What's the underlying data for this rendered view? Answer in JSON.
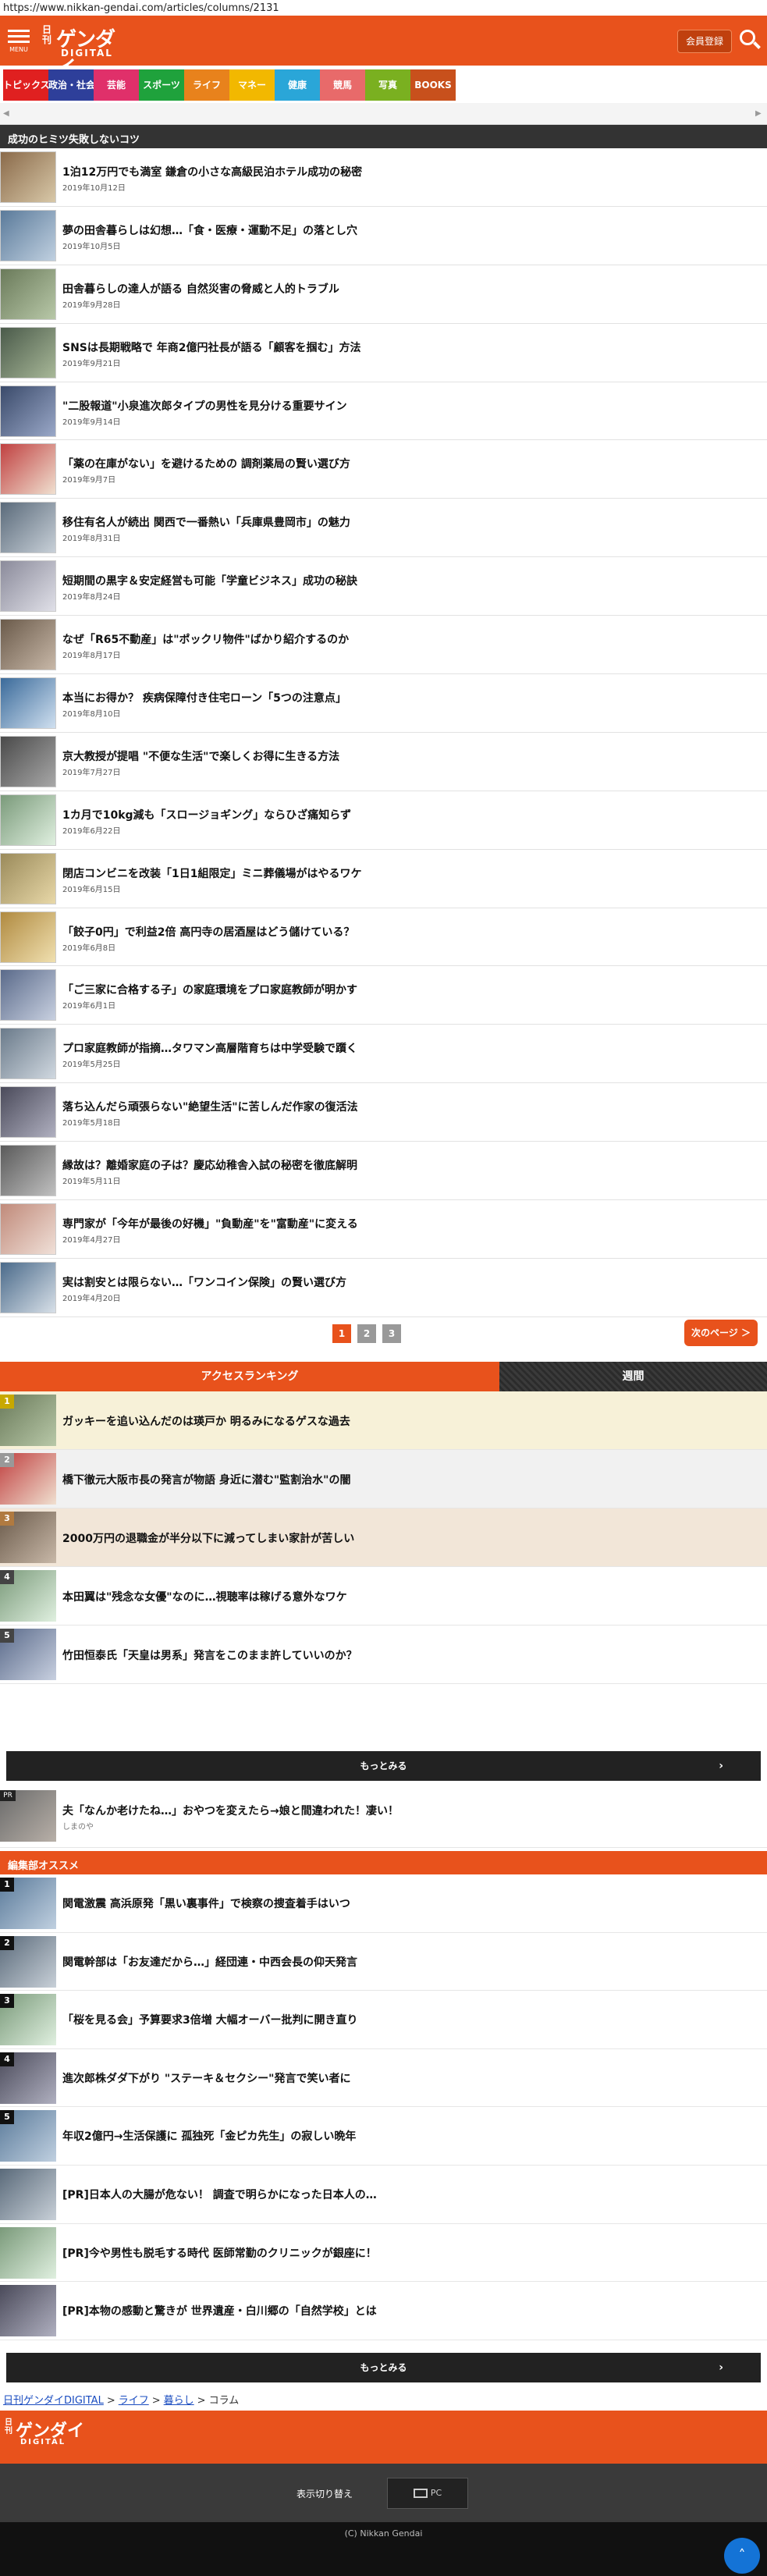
{
  "browser": {
    "url": "https://www.nikkan-gendai.com/articles/columns/2131"
  },
  "header": {
    "menu_label": "MENU",
    "logo_nikkan": "日刊",
    "logo_gendai": "ゲンダイ",
    "logo_digital": "DIGITAL",
    "member_button": "会員登録",
    "brand_color": "#e8521c"
  },
  "categories": [
    {
      "label": "トピックス",
      "color": "#e02020"
    },
    {
      "label": "政治・社会",
      "color": "#2e3f9a"
    },
    {
      "label": "芸能",
      "color": "#e0306a"
    },
    {
      "label": "スポーツ",
      "color": "#1fa23c"
    },
    {
      "label": "ライフ",
      "color": "#e8821c"
    },
    {
      "label": "マネー",
      "color": "#f2b800"
    },
    {
      "label": "健康",
      "color": "#2aa6d8"
    },
    {
      "label": "競馬",
      "color": "#e86a6a"
    },
    {
      "label": "写真",
      "color": "#7ab020"
    },
    {
      "label": "BOOKS",
      "color": "#c8501c"
    }
  ],
  "section_title": "成功のヒミツ失敗しないコツ",
  "articles": [
    {
      "title": "1泊12万円でも満室 鎌倉の小さな高級民泊ホテル成功の秘密",
      "date": "2019年10月12日"
    },
    {
      "title": "夢の田舎暮らしは幻想…「食・医療・運動不足」の落とし穴",
      "date": "2019年10月5日"
    },
    {
      "title": "田舎暮らしの達人が語る 自然災害の脅威と人的トラブル",
      "date": "2019年9月28日"
    },
    {
      "title": "SNSは長期戦略で 年商2億円社長が語る「顧客を掴む」方法",
      "date": "2019年9月21日"
    },
    {
      "title": "\"二股報道\"小泉進次郎タイプの男性を見分ける重要サイン",
      "date": "2019年9月14日"
    },
    {
      "title": "「薬の在庫がない」を避けるための 調剤薬局の賢い選び方",
      "date": "2019年9月7日"
    },
    {
      "title": "移住有名人が続出 関西で一番熱い「兵庫県豊岡市」の魅力",
      "date": "2019年8月31日"
    },
    {
      "title": "短期間の黒字＆安定経営も可能「学童ビジネス」成功の秘訣",
      "date": "2019年8月24日"
    },
    {
      "title": "なぜ「R65不動産」は\"ポックリ物件\"ばかり紹介するのか",
      "date": "2019年8月17日"
    },
    {
      "title": "本当にお得か？ 疾病保障付き住宅ローン「5つの注意点」",
      "date": "2019年8月10日"
    },
    {
      "title": "京大教授が提唱 \"不便な生活\"で楽しくお得に生きる方法",
      "date": "2019年7月27日"
    },
    {
      "title": "1カ月で10kg減も「スロージョギング」ならひざ痛知らず",
      "date": "2019年6月22日"
    },
    {
      "title": "閉店コンビニを改装「1日1組限定」ミニ葬儀場がはやるワケ",
      "date": "2019年6月15日"
    },
    {
      "title": "「餃子0円」で利益2倍 高円寺の居酒屋はどう儲けている？",
      "date": "2019年6月8日"
    },
    {
      "title": "「ご三家に合格する子」の家庭環境をプロ家庭教師が明かす",
      "date": "2019年6月1日"
    },
    {
      "title": "プロ家庭教師が指摘…タワマン高層階育ちは中学受験で躓く",
      "date": "2019年5月25日"
    },
    {
      "title": "落ち込んだら頑張らない\"絶望生活\"に苦しんだ作家の復活法",
      "date": "2019年5月18日"
    },
    {
      "title": "縁故は？離婚家庭の子は？慶応幼稚舎入試の秘密を徹底解明",
      "date": "2019年5月11日"
    },
    {
      "title": "専門家が「今年が最後の好機」\"負動産\"を\"富動産\"に変える",
      "date": "2019年4月27日"
    },
    {
      "title": "実は割安とは限らない…「ワンコイン保険」の賢い選び方",
      "date": "2019年4月20日"
    }
  ],
  "pager": {
    "pages": [
      "1",
      "2",
      "3"
    ],
    "next_label": "次のページ ＞"
  },
  "ranking_tabs": {
    "access": "アクセスランキング",
    "weekly": "週間"
  },
  "ranking": [
    {
      "rank": "1",
      "title": "ガッキーを追い込んだのは瑛戸か 明るみになるゲスな過去",
      "bg": "#f7f1d8",
      "badge": "#c8a800"
    },
    {
      "rank": "2",
      "title": "橋下徹元大阪市長の発言が物語 身近に潜む\"監割治水\"の闇",
      "bg": "#f1f1f1",
      "badge": "#999999"
    },
    {
      "rank": "3",
      "title": "2000万円の退職金が半分以下に減ってしまい家計が苦しい",
      "bg": "#f2e6d8",
      "badge": "#b07a40"
    },
    {
      "rank": "4",
      "title": "本田翼は\"残念な女優\"なのに…視聴率は稼げる意外なワケ",
      "bg": "#ffffff",
      "badge": "#444444"
    },
    {
      "rank": "5",
      "title": "竹田恒泰氏「天皇は男系」発言をこのまま許していいのか？",
      "bg": "#ffffff",
      "badge": "#444444"
    }
  ],
  "more_label": "もっとみる",
  "pr_item": {
    "tag": "PR",
    "title": "夫「なんか老けたね…」おやつを変えたら→娘と間違われた！凄い！",
    "source": "しまのや"
  },
  "osusume_title": "編集部オススメ",
  "osusume": [
    {
      "rank": "1",
      "title": "関電激震 高浜原発「黒い裏事件」で検察の捜査着手はいつ"
    },
    {
      "rank": "2",
      "title": "関電幹部は「お友達だから…」経団連・中西会長の仰天発言"
    },
    {
      "rank": "3",
      "title": "「桜を見る会」予算要求3倍増 大幅オーバー批判に開き直り"
    },
    {
      "rank": "4",
      "title": "進次郎株ダダ下がり \"ステーキ＆セクシー\"発言で笑い者に"
    },
    {
      "rank": "5",
      "title": "年収2億円→生活保護に 孤独死「金ピカ先生」の寂しい晩年"
    },
    {
      "rank": "",
      "title": "[PR]日本人の大腸が危ない！ 調査で明らかになった日本人の…"
    },
    {
      "rank": "",
      "title": "[PR]今や男性も脱毛する時代 医師常勤のクリニックが銀座に！"
    },
    {
      "rank": "",
      "title": "[PR]本物の感動と驚きが 世界遺産・白川郷の「自然学校」とは"
    }
  ],
  "breadcrumb": [
    "日刊ゲンダイDIGITAL",
    "ライフ",
    "暮らし",
    "コラム"
  ],
  "breadcrumb_sep": ">",
  "footer": {
    "switch_label": "表示切り替え",
    "pc_label": "PC",
    "copyright": "(C) Nikkan Gendai"
  }
}
